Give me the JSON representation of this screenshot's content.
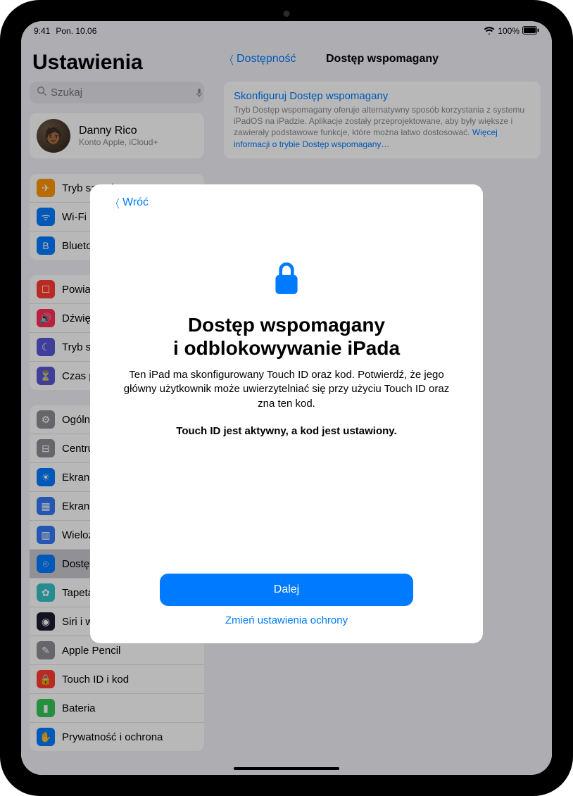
{
  "status": {
    "time": "9:41",
    "date": "Pon. 10.06",
    "wifi": "wifi",
    "battery_pct": "100%"
  },
  "sidebar": {
    "title": "Ustawienia",
    "search_placeholder": "Szukaj",
    "account": {
      "name": "Danny Rico",
      "sub": "Konto Apple, iCloud+"
    },
    "group1": [
      {
        "label": "Tryb samolot",
        "color": "#ff9500",
        "glyph": "✈"
      },
      {
        "label": "Wi-Fi",
        "color": "#007aff",
        "glyph": "ᯤ"
      },
      {
        "label": "Bluetooth",
        "color": "#007aff",
        "glyph": "B"
      }
    ],
    "group2": [
      {
        "label": "Powiadomienia",
        "color": "#ff3b30",
        "glyph": "☐"
      },
      {
        "label": "Dźwięki",
        "color": "#ff2d55",
        "glyph": "🔊"
      },
      {
        "label": "Tryb skupienia",
        "color": "#5856d6",
        "glyph": "☾"
      },
      {
        "label": "Czas przed ekranem",
        "color": "#5856d6",
        "glyph": "⏳"
      }
    ],
    "group3": [
      {
        "label": "Ogólne",
        "color": "#8e8e93",
        "glyph": "⚙"
      },
      {
        "label": "Centrum sterowania",
        "color": "#8e8e93",
        "glyph": "⊟"
      },
      {
        "label": "Ekran i jasność",
        "color": "#007aff",
        "glyph": "☀"
      },
      {
        "label": "Ekran początkowy i Dock",
        "color": "#3478f6",
        "glyph": "▦"
      },
      {
        "label": "Wielozadaniowość i gesty",
        "color": "#3478f6",
        "glyph": "▥"
      },
      {
        "label": "Dostępność",
        "color": "#007aff",
        "glyph": "⌾",
        "selected": true
      },
      {
        "label": "Tapeta",
        "color": "#34c2c7",
        "glyph": "✿"
      },
      {
        "label": "Siri i wyszukiwanie",
        "color": "#1b1b2f",
        "glyph": "◉"
      },
      {
        "label": "Apple Pencil",
        "color": "#8e8e93",
        "glyph": "✎"
      },
      {
        "label": "Touch ID i kod",
        "color": "#ff3b30",
        "glyph": "🔒"
      },
      {
        "label": "Bateria",
        "color": "#34c759",
        "glyph": "▮"
      },
      {
        "label": "Prywatność i ochrona",
        "color": "#007aff",
        "glyph": "✋"
      }
    ]
  },
  "detail": {
    "back_label": "Dostępność",
    "title": "Dostęp wspomagany",
    "config_link": "Skonfiguruj Dostęp wspomagany",
    "desc": "Tryb Dostęp wspomagany oferuje alternatywny sposób korzystania z systemu iPadOS na iPadzie. Aplikacje zostały przeprojektowane, aby były większe i zawierały podstawowe funkcje, które można łatwo dostosować. ",
    "more": "Więcej informacji o trybie Dostęp wspomagany…"
  },
  "modal": {
    "back": "Wróć",
    "title_line1": "Dostęp wspomagany",
    "title_line2": "i odblokowywanie iPada",
    "desc": "Ten iPad ma skonfigurowany Touch ID oraz kod. Potwierdź, że jego główny użytkownik może uwierzytelniać się przy użyciu Touch ID oraz zna ten kod.",
    "bold": "Touch ID jest aktywny, a kod jest ustawiony.",
    "primary": "Dalej",
    "secondary": "Zmień ustawienia ochrony"
  }
}
